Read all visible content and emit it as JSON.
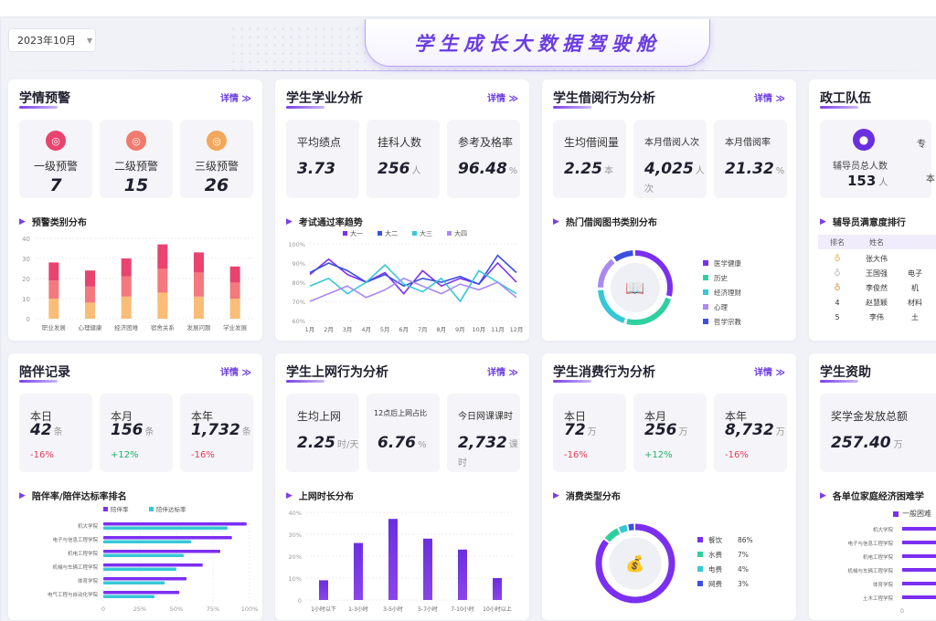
{
  "header": {
    "date_value": "2023年10月",
    "title": "学生成长大数据驾驶舱"
  },
  "colors": {
    "accent": "#7b3fe4",
    "up": "#1fb36b",
    "down": "#e5395a"
  },
  "common": {
    "more": "详情 ≫"
  },
  "cards": {
    "warning": {
      "title": "学情预警",
      "items": [
        {
          "label": "一级预警",
          "value": "7",
          "color": "#e9436f"
        },
        {
          "label": "二级预警",
          "value": "15",
          "color": "#f07a6c"
        },
        {
          "label": "三级预警",
          "value": "26",
          "color": "#f4a65a"
        }
      ],
      "sub_title": "预警类别分布"
    },
    "academic": {
      "title": "学生学业分析",
      "stats": [
        {
          "label": "平均绩点",
          "value": "3.73",
          "unit": ""
        },
        {
          "label": "挂科人数",
          "value": "256",
          "unit": "人"
        },
        {
          "label": "参考及格率",
          "value": "96.48",
          "unit": "%"
        }
      ],
      "sub_title": "考试通过率趋势"
    },
    "borrow": {
      "title": "学生借阅行为分析",
      "stats": [
        {
          "label": "生均借阅量",
          "value": "2.25",
          "unit": "本"
        },
        {
          "label": "本月借阅人次",
          "value": "4,025",
          "unit": "人次"
        },
        {
          "label": "本月借阅率",
          "value": "21.32",
          "unit": "%"
        }
      ],
      "sub_title": "热门借阅图书类别分布"
    },
    "counselor": {
      "title": "政工队伍",
      "stat_label": "辅导员总人数",
      "stat_value": "153",
      "stat_unit": "人",
      "extra_1": "专",
      "extra_2": "本",
      "sub_title": "辅导员满意度排行",
      "table_headers": [
        "排名",
        "姓名"
      ],
      "rows": [
        {
          "rank": "1",
          "name": "张大伟",
          "extra": ""
        },
        {
          "rank": "2",
          "name": "王国强",
          "extra": "电子"
        },
        {
          "rank": "3",
          "name": "李俊然",
          "extra": "机"
        },
        {
          "rank": "4",
          "name": "赵慧颖",
          "extra": "材料"
        },
        {
          "rank": "5",
          "name": "李伟",
          "extra": "土"
        }
      ]
    },
    "company": {
      "title": "陪伴记录",
      "stats": [
        {
          "label": "本日",
          "value": "42",
          "unit": "条",
          "change": "-16%",
          "dir": "down"
        },
        {
          "label": "本月",
          "value": "156",
          "unit": "条",
          "change": "+12%",
          "dir": "up"
        },
        {
          "label": "本年",
          "value": "1,732",
          "unit": "条",
          "change": "-16%",
          "dir": "down"
        }
      ],
      "sub_title": "陪伴率/陪伴达标率排名"
    },
    "online": {
      "title": "学生上网行为分析",
      "stats": [
        {
          "label": "生均上网",
          "value": "2.25",
          "unit": "时/天"
        },
        {
          "label": "12点后上网占比",
          "value": "6.76",
          "unit": "%"
        },
        {
          "label": "今日网课课时",
          "value": "2,732",
          "unit": "课时"
        }
      ],
      "sub_title": "上网时长分布"
    },
    "consume": {
      "title": "学生消费行为分析",
      "stats": [
        {
          "label": "本日",
          "value": "72",
          "unit": "万",
          "change": "-16%",
          "dir": "down"
        },
        {
          "label": "本月",
          "value": "256",
          "unit": "万",
          "change": "+12%",
          "dir": "up"
        },
        {
          "label": "本年",
          "value": "8,732",
          "unit": "万",
          "change": "-16%",
          "dir": "down"
        }
      ],
      "sub_title": "消费类型分布"
    },
    "aid": {
      "title": "学生资助",
      "stat_label": "奖学金发放总额",
      "stat_value": "257.40",
      "stat_unit": "万",
      "sub_title": "各单位家庭经济困难学",
      "legend": "一般困难",
      "units": [
        "机大学院",
        "电子与信息工程学院",
        "机电工程学院",
        "机械与车辆工程学院",
        "体育学院",
        "土木工程学院"
      ]
    }
  },
  "chart_data": [
    {
      "type": "bar",
      "title": "预警类别分布",
      "categories": [
        "职业发展",
        "心理健康",
        "经济困难",
        "宿舍关系",
        "发展问题",
        "学业发展"
      ],
      "series": [
        {
          "values": [
            10,
            8,
            11,
            13,
            11,
            10
          ],
          "color": "#f9bd78"
        },
        {
          "values": [
            9,
            8,
            10,
            12,
            12,
            8
          ],
          "color": "#f3797e"
        },
        {
          "values": [
            9,
            8,
            9,
            12,
            10,
            8
          ],
          "color": "#e9436f"
        }
      ],
      "ylim": [
        0,
        40
      ],
      "yticks": [
        0,
        10,
        20,
        30,
        40
      ]
    },
    {
      "type": "line",
      "title": "考试通过率趋势",
      "categories": [
        "1月",
        "2月",
        "3月",
        "4月",
        "5月",
        "6月",
        "7月",
        "8月",
        "9月",
        "10月",
        "11月",
        "12月"
      ],
      "series": [
        {
          "name": "大一",
          "values": [
            84,
            92,
            84,
            80,
            85,
            74,
            86,
            78,
            82,
            79,
            90,
            80
          ],
          "color": "#7b2ff0"
        },
        {
          "name": "大二",
          "values": [
            85,
            90,
            86,
            80,
            84,
            78,
            82,
            80,
            83,
            79,
            94,
            85
          ],
          "color": "#3b4fe0"
        },
        {
          "name": "大三",
          "values": [
            78,
            82,
            74,
            80,
            89,
            79,
            75,
            82,
            70,
            86,
            80,
            74
          ],
          "color": "#36c8d6"
        },
        {
          "name": "大四",
          "values": [
            70,
            74,
            78,
            72,
            76,
            82,
            78,
            74,
            79,
            76,
            80,
            72
          ],
          "color": "#a98af0"
        }
      ],
      "ylim": [
        60,
        100
      ],
      "yticks": [
        "60%",
        "70%",
        "80%",
        "90%",
        "100%"
      ]
    },
    {
      "type": "pie",
      "title": "热门借阅图书类别分布",
      "labels": [
        "医学健康",
        "历史",
        "经济理财",
        "心理",
        "哲学宗教"
      ],
      "values": [
        30,
        25,
        20,
        15,
        10
      ],
      "colors": [
        "#7b2ff0",
        "#2fd0a0",
        "#36c8d6",
        "#a98af0",
        "#3b4fe0"
      ]
    },
    {
      "type": "bar",
      "title": "陪伴率/陪伴达标率排名",
      "orientation": "horizontal",
      "categories": [
        "机大学院",
        "电子与信息工程学院",
        "机电工程学院",
        "机械与车辆工程学院",
        "体育学院",
        "电气工程与自动化学院"
      ],
      "series": [
        {
          "name": "陪伴率",
          "values": [
            98,
            88,
            80,
            68,
            57,
            52
          ],
          "color": "#7b2ff0"
        },
        {
          "name": "陪伴达标率",
          "values": [
            85,
            60,
            55,
            50,
            42,
            35
          ],
          "color": "#36c8d6"
        }
      ],
      "xticks": [
        "0",
        "25%",
        "50%",
        "75%",
        "100%"
      ]
    },
    {
      "type": "bar",
      "title": "上网时长分布",
      "categories": [
        "1小时以下",
        "1-3小时",
        "3-5小时",
        "5-7小时",
        "7-10小时",
        "10小时以上"
      ],
      "values": [
        9,
        26,
        37,
        28,
        23,
        10
      ],
      "ylim": [
        0,
        40
      ],
      "yticks": [
        "0",
        "10%",
        "20%",
        "30%",
        "40%"
      ]
    },
    {
      "type": "pie",
      "title": "消费类型分布",
      "labels": [
        "餐饮",
        "水费",
        "电费",
        "网费"
      ],
      "values": [
        86,
        7,
        4,
        3
      ],
      "value_labels": [
        "86%",
        "7%",
        "4%",
        "3%"
      ],
      "colors": [
        "#7b2ff0",
        "#2fd0a0",
        "#36c8d6",
        "#3b4fe0"
      ]
    }
  ]
}
